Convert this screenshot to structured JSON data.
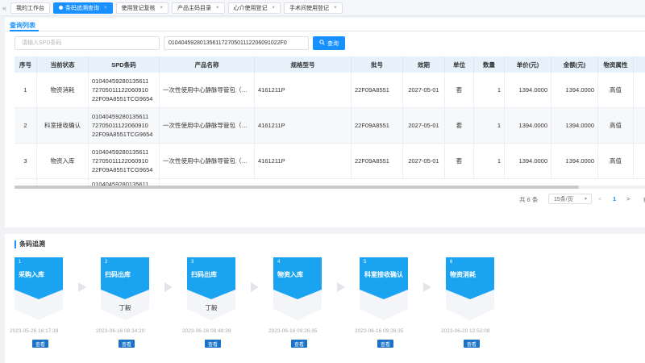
{
  "tabs": [
    {
      "label": "我的工作台",
      "active": false,
      "closable": false
    },
    {
      "label": "条码追溯查询",
      "active": true,
      "closable": true
    },
    {
      "label": "使用登记复核",
      "active": false,
      "closable": true
    },
    {
      "label": "产品主码目录",
      "active": false,
      "closable": true
    },
    {
      "label": "心介使用登记",
      "active": false,
      "closable": true
    },
    {
      "label": "手术间使用登记",
      "active": false,
      "closable": true
    }
  ],
  "subtab": {
    "label": "查询列表"
  },
  "search": {
    "placeholder": "请输入SPD条码",
    "code_value": "010404592801356117270501112206091022F0",
    "button_label": "查询"
  },
  "table": {
    "headers": [
      "序号",
      "当前状态",
      "SPD条码",
      "产品名称",
      "规格型号",
      "批号",
      "效期",
      "单位",
      "数量",
      "单价(元)",
      "金额(元)",
      "物资属性"
    ],
    "rows": [
      {
        "no": "1",
        "status": "物资消耗",
        "spd": "01040459280135611\n72705011122060910\n22F09A8551TCG9654",
        "name": "一次性使用中心静脉导管包（…",
        "spec": "4161211P",
        "batch": "22F09A8551",
        "expiry": "2027-05-01",
        "unit": "套",
        "qty": "1",
        "price": "1394.0000",
        "amount": "1394.0000",
        "attr": "高值"
      },
      {
        "no": "2",
        "status": "科室接收确认",
        "spd": "01040459280135611\n72705011122060910\n22F09A8551TCG9654",
        "name": "一次性使用中心静脉导管包（…",
        "spec": "4161211P",
        "batch": "22F09A8551",
        "expiry": "2027-05-01",
        "unit": "套",
        "qty": "1",
        "price": "1394.0000",
        "amount": "1394.0000",
        "attr": "高值"
      },
      {
        "no": "3",
        "status": "物资入库",
        "spd": "01040459280135611\n72705011122060910\n22F09A8551TCG9654",
        "name": "一次性使用中心静脉导管包（…",
        "spec": "4161211P",
        "batch": "22F09A8551",
        "expiry": "2027-05-01",
        "unit": "套",
        "qty": "1",
        "price": "1394.0000",
        "amount": "1394.0000",
        "attr": "高值"
      }
    ],
    "partial_row_spd": "01040459280135611"
  },
  "pager": {
    "total": "共 6 条",
    "page_size": "15条/页",
    "prev": "<",
    "page": "1",
    "next": ">",
    "jump": "前"
  },
  "trace": {
    "title": "条码追溯",
    "steps": [
      {
        "num": "1",
        "label": "采购入库",
        "person": "",
        "time": "2023-05-26 16:17:39",
        "view": "查看"
      },
      {
        "num": "2",
        "label": "扫码出库",
        "person": "丁毅",
        "time": "2023-06-16 08:34:20",
        "view": "查看"
      },
      {
        "num": "3",
        "label": "扫码出库",
        "person": "丁毅",
        "time": "2023-06-16 08:48:39",
        "view": "查看"
      },
      {
        "num": "4",
        "label": "物资入库",
        "person": "",
        "time": "2023-06-16 09:26:35",
        "view": "查看"
      },
      {
        "num": "5",
        "label": "科室接收确认",
        "person": "",
        "time": "2023-06-16 09:26:35",
        "view": "查看"
      },
      {
        "num": "6",
        "label": "物资消耗",
        "person": "",
        "time": "2023-06-20 12:52:08",
        "view": "查看"
      }
    ]
  },
  "colors": {
    "accent": "#1890ff",
    "card_top": "#1aa3f0",
    "card_body": "#f3f5f8",
    "header_bg": "#e6f1fb",
    "view_btn": "#1a73c8"
  }
}
